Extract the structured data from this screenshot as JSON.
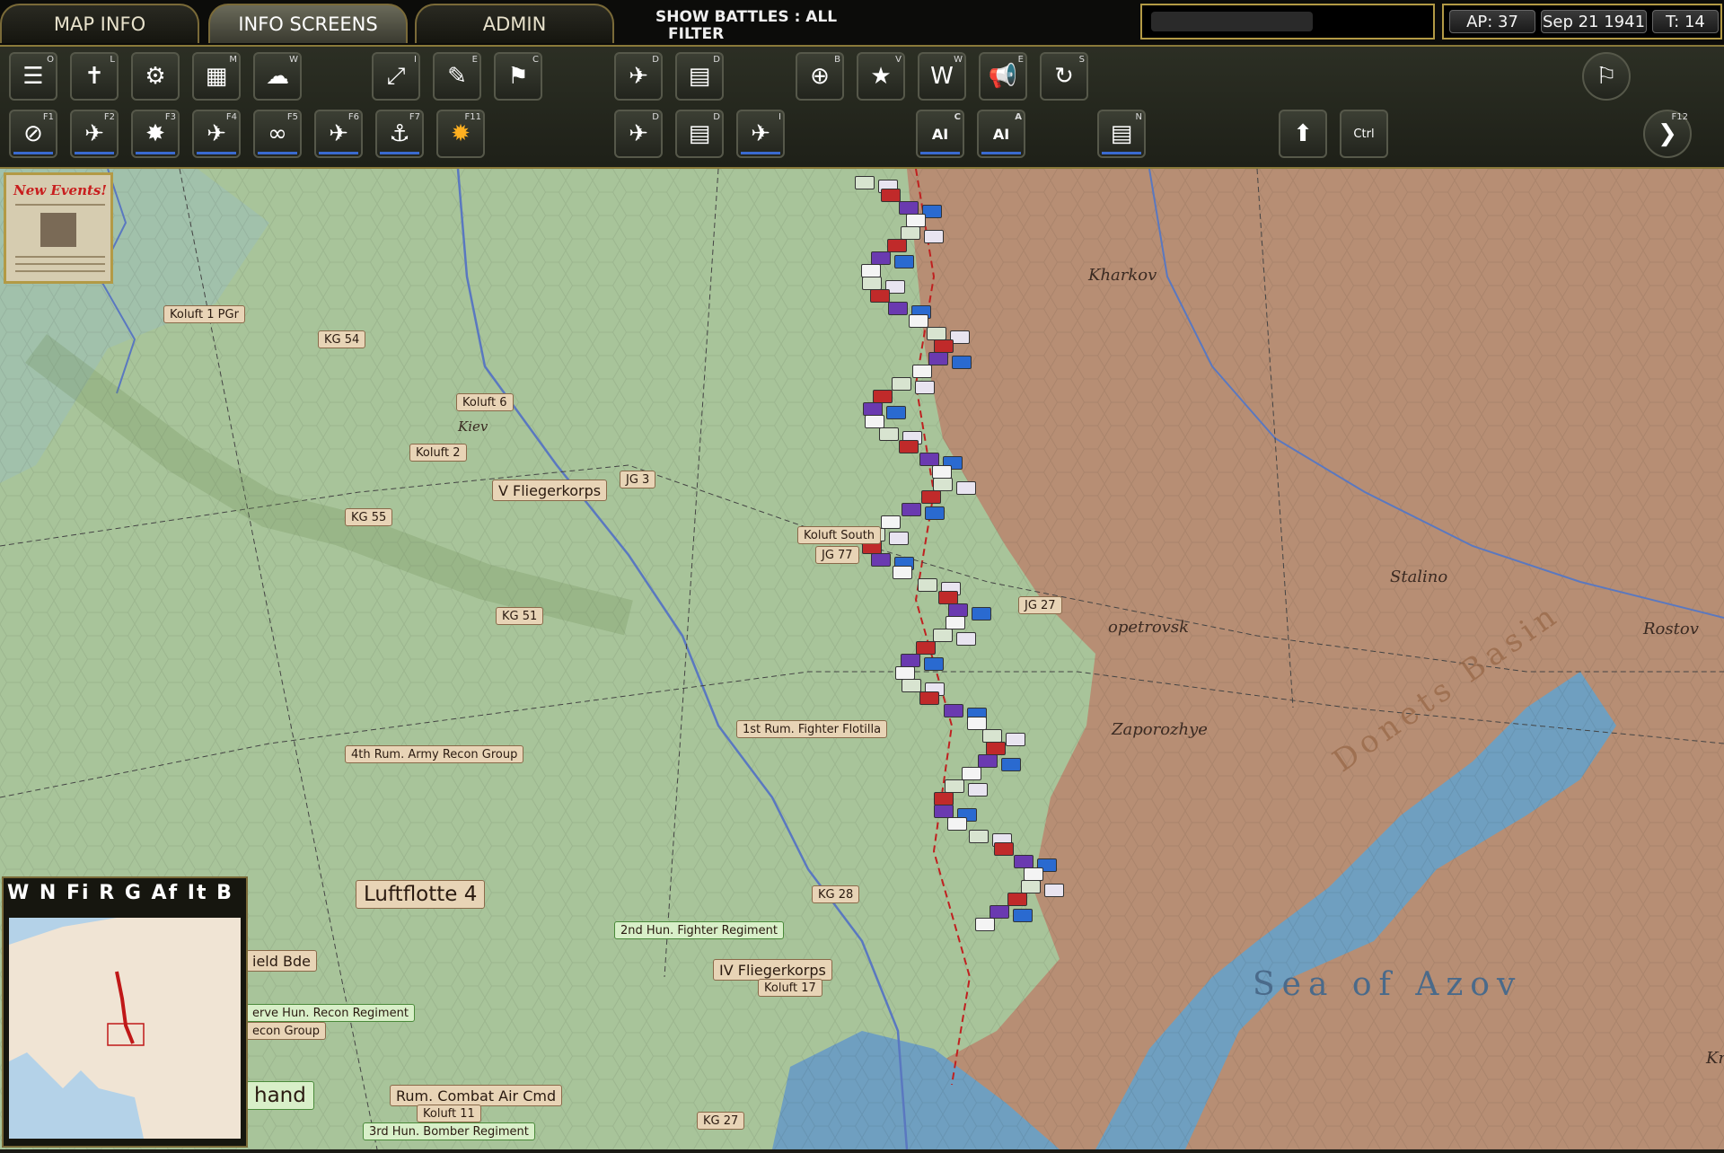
{
  "tabs": {
    "map_info": "MAP INFO",
    "info_screens": "INFO SCREENS",
    "admin": "ADMIN"
  },
  "filter": {
    "line1": "SHOW BATTLES : ALL",
    "line2": "FILTER"
  },
  "status": {
    "ap": "AP: 37",
    "date": "Sep 21 1941",
    "turn": "T: 14"
  },
  "toolbar": {
    "row1_keys": [
      "O",
      "L",
      "",
      "M",
      "W",
      "I",
      "E",
      "C",
      "D",
      "D",
      "B",
      "V",
      "W",
      "E",
      "S"
    ],
    "row2_keys": [
      "F1",
      "F2",
      "F3",
      "F4",
      "F5",
      "F6",
      "F7",
      "F11",
      "D",
      "D",
      "I",
      "C",
      "A",
      "N"
    ],
    "ctrl_label": "Ctrl",
    "next_key": "F12"
  },
  "new_events": "New Events!",
  "map_labels": {
    "koluft1pgr": "Koluft 1 PGr",
    "kg54": "KG 54",
    "koluft6": "Koluft 6",
    "koluft2": "Koluft 2",
    "vfliegerkorps": "V Fliegerkorps",
    "jg3": "JG 3",
    "kg55": "KG 55",
    "kg51": "KG 51",
    "koluftsouth": "Koluft South",
    "jg77": "JG 77",
    "jg27": "JG 27",
    "rum_fighter": "1st Rum. Fighter Flotilla",
    "rum_recon": "4th Rum. Army Recon Group",
    "luftflotte4": "Luftflotte 4",
    "kg28": "KG 28",
    "hun_fighter": "2nd Hun. Fighter Regiment",
    "ivfliegerkorps": "IV Fliegerkorps",
    "koluft17": "Koluft 17",
    "field_bde": "ield Bde",
    "hun_recon": "erve Hun. Recon Regiment",
    "recon_group": "econ Group",
    "hand": "hand",
    "rum_combat": "Rum. Combat Air Cmd",
    "koluft11": "Koluft 11",
    "hun_bomber": "3rd Hun. Bomber Regiment",
    "kg27": "KG 27"
  },
  "cities": {
    "kharkov": "Kharkov",
    "kiev": "Kiev",
    "stalino": "Stalino",
    "dnepr": "opetrovsk",
    "zaporozhye": "Zaporozhye",
    "rostov": "Rostov",
    "kr": "Kr"
  },
  "sea": "Sea of Azov",
  "basin": "Donets Basin",
  "minimap_filter": "W N Fi R G Af It B",
  "colors": {
    "front_tan": "#b78e74",
    "green": "#a8c49a",
    "water": "#6f9fc0"
  }
}
